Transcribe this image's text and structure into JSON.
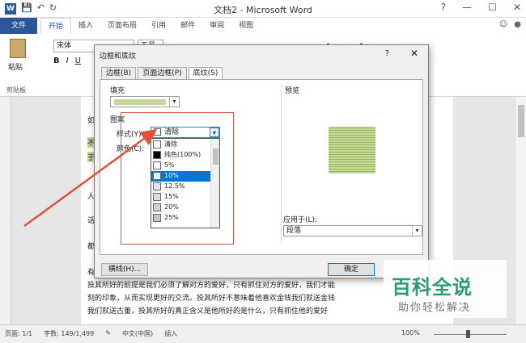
{
  "window": {
    "title": "文档2 - Microsoft Word",
    "controls": [
      "?",
      "—",
      "☐",
      "✕"
    ]
  },
  "ribbon_tabs": {
    "file": "文件",
    "tabs": [
      "开始",
      "插入",
      "页面布局",
      "引用",
      "邮件",
      "审阅",
      "视图"
    ]
  },
  "ribbon": {
    "paste": "粘贴",
    "clipboard": "剪贴板",
    "font_name": "宋体",
    "font_size": "五号"
  },
  "document": {
    "lines": [
      "如",
      "不",
      "于",
      "人",
      "话",
      "都",
      "有",
      "投其所好的前提是我们必须了解对方的爱好，只有抓住对方的爱好，我们才能",
      "刻的印象，从而实现更好的交流。投其所好不意味着他喜欢金钱我们就送金钱",
      "我们就送古董，投其所好的真正含义是他所好的是什么，只有抓住他的爱好"
    ]
  },
  "dialog": {
    "title": "边框和底纹",
    "help": "?",
    "close": "✕",
    "tabs": [
      "边框(B)",
      "页面边框(P)",
      "底纹(S)"
    ],
    "active_tab": 2,
    "fill_label": "填充",
    "fill_color": "#c4d79b",
    "pattern_label": "图案",
    "style_label": "样式(Y):",
    "color_label": "颜色(C):",
    "style_value": "清除",
    "style_options": [
      "清除",
      "纯色(100%)",
      "5%",
      "10%",
      "12.5%",
      "15%",
      "20%",
      "25%"
    ],
    "selected_option": 3,
    "preview_label": "预览",
    "apply_label": "应用于(L):",
    "apply_value": "段落",
    "borders_button": "横线(H)...",
    "ok_button": "确定"
  },
  "statusbar": {
    "page": "页面: 1/1",
    "words": "字数: 149/1,499",
    "language": "中文(中国)",
    "mode": "插入",
    "zoom": "100%"
  },
  "watermark": {
    "main": "百科全说",
    "sub": "助你轻松解决"
  }
}
